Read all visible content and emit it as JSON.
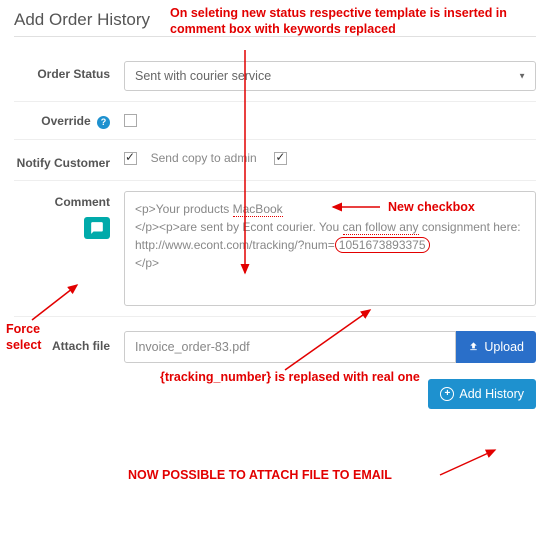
{
  "title": "Add Order History",
  "labels": {
    "order_status": "Order Status",
    "override": "Override",
    "notify": "Notify Customer",
    "comment": "Comment",
    "attach": "Attach file"
  },
  "order_status_value": "Sent with courier service",
  "send_copy_label": "Send copy to admin",
  "comment_p1": "<p>Your products ",
  "comment_product": "MacBook",
  "comment_p2": "</p><p>are sent by Econt courier. You ",
  "comment_p2b": "can follow any",
  "comment_p2c": " consignment here: http://www.econt.com/tracking/?num=",
  "comment_tracking": "1051673893375",
  "comment_p3": "</p>",
  "attach_value": "Invoice_order-83.pdf",
  "upload_label": "Upload",
  "add_history_label": "Add History",
  "anno": {
    "top": "On seleting new status respective template is inserted in comment box with keywords replaced",
    "new_checkbox": "New checkbox",
    "force_select": "Force select",
    "tracking_note": "{tracking_number} is replased with real one",
    "attach_note": "NOW POSSIBLE TO ATTACH FILE TO EMAIL"
  }
}
